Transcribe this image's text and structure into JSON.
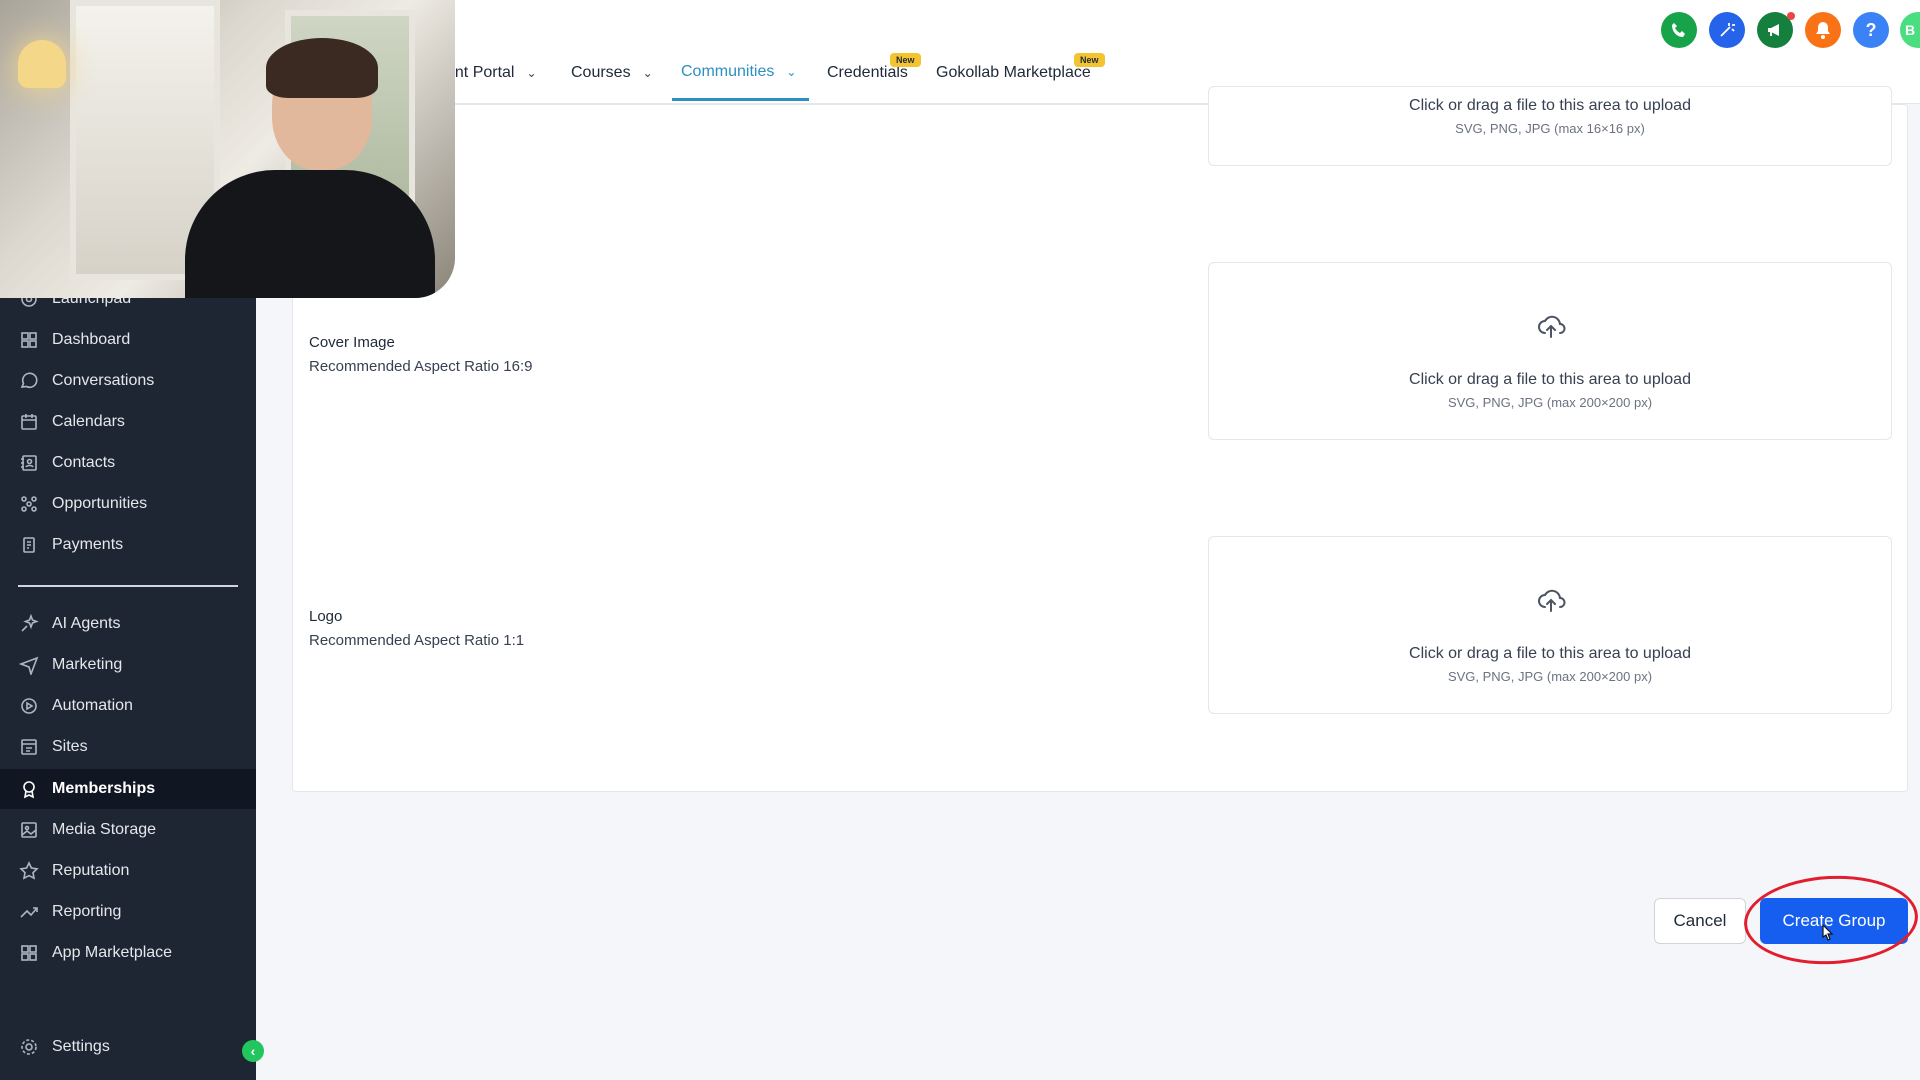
{
  "sidebar": {
    "items": [
      {
        "label": "Launchpad",
        "icon": "rocket-icon"
      },
      {
        "label": "Dashboard",
        "icon": "grid-icon"
      },
      {
        "label": "Conversations",
        "icon": "chat-icon"
      },
      {
        "label": "Calendars",
        "icon": "calendar-icon"
      },
      {
        "label": "Contacts",
        "icon": "contacts-icon"
      },
      {
        "label": "Opportunities",
        "icon": "opportunities-icon"
      },
      {
        "label": "Payments",
        "icon": "payments-icon"
      },
      {
        "label": "AI Agents",
        "icon": "sparkle-icon"
      },
      {
        "label": "Marketing",
        "icon": "send-icon"
      },
      {
        "label": "Automation",
        "icon": "automation-icon"
      },
      {
        "label": "Sites",
        "icon": "sites-icon"
      },
      {
        "label": "Memberships",
        "icon": "award-icon",
        "active": true
      },
      {
        "label": "Media Storage",
        "icon": "image-icon"
      },
      {
        "label": "Reputation",
        "icon": "star-icon"
      },
      {
        "label": "Reporting",
        "icon": "trend-icon"
      },
      {
        "label": "App Marketplace",
        "icon": "apps-icon"
      }
    ],
    "settings_label": "Settings",
    "collapse_glyph": "‹"
  },
  "topbar": {
    "tabs": [
      {
        "label": "ent Portal",
        "has_chevron": true
      },
      {
        "label": "Courses",
        "has_chevron": true
      },
      {
        "label": "Communities",
        "has_chevron": true,
        "active": true
      },
      {
        "label": "Credentials",
        "badge": "New"
      },
      {
        "label": "Gokollab Marketplace",
        "badge": "New"
      }
    ],
    "chevron_glyph": "⌄",
    "avatar_initial": "B",
    "icon_colors": {
      "phone": "#16a34a",
      "magic": "#2563eb",
      "announce": "#15803d",
      "bell": "#f97316",
      "help": "#3b82f6",
      "avatar": "#4ade80"
    }
  },
  "form": {
    "favicon_upload": {
      "text": "Click or drag a file to this area to upload",
      "sub": "SVG, PNG, JPG (max 16×16 px)"
    },
    "cover": {
      "label": "Cover Image",
      "hint": "Recommended Aspect Ratio 16:9",
      "upload_text": "Click or drag a file to this area to upload",
      "upload_sub": "SVG, PNG, JPG (max 200×200 px)"
    },
    "logo": {
      "label": "Logo",
      "hint": "Recommended Aspect Ratio 1:1",
      "upload_text": "Click or drag a file to this area to upload",
      "upload_sub": "SVG, PNG, JPG (max 200×200 px)"
    }
  },
  "footer": {
    "cancel_label": "Cancel",
    "create_label": "Create Group"
  },
  "colors": {
    "sidebar_bg": "#1e2633",
    "accent": "#2d8fc2",
    "primary_button": "#155eef",
    "annotation": "#e11d2e",
    "badge": "#f4c430"
  }
}
